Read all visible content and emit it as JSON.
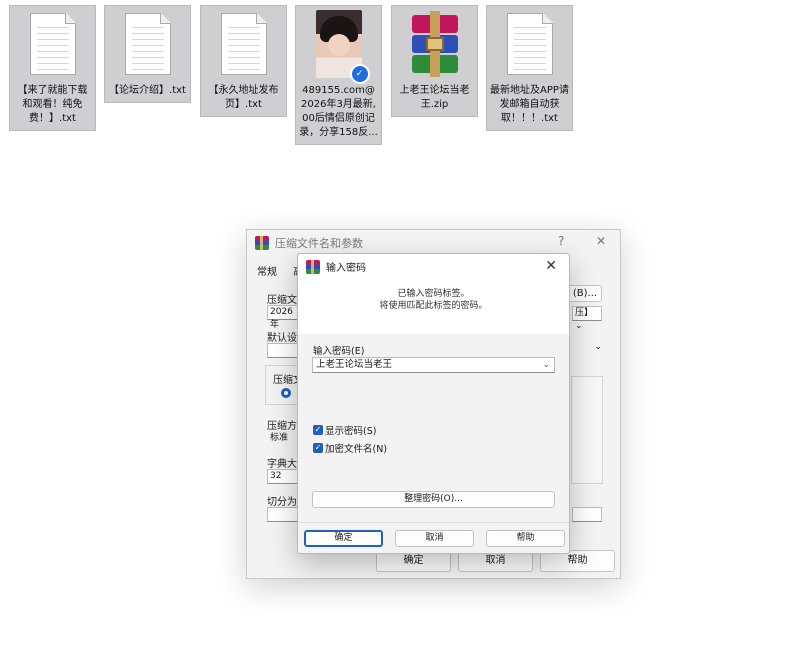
{
  "desktop_files": [
    {
      "name": "【来了就能下载和观看！纯免费！】.txt",
      "type": "txt"
    },
    {
      "name": "【论坛介绍】.txt",
      "type": "txt"
    },
    {
      "name": "【永久地址发布页】.txt",
      "type": "txt"
    },
    {
      "name": "489155.com@2026年3月最新,00后情侣原创记录，分享158反...",
      "type": "image"
    },
    {
      "name": "上老王论坛当老王.zip",
      "type": "zip"
    },
    {
      "name": "最新地址及APP请发邮箱自动获取！！！.txt",
      "type": "txt"
    }
  ],
  "main_dialog": {
    "title": "压缩文件名和参数",
    "help_glyph": "?",
    "close_glyph": "✕",
    "tab_general": "常规",
    "tab_advanced_partial": "高",
    "label_archive_name": "压缩文件",
    "archive_name_value": "2026年",
    "browse_partial": "(B)...",
    "format_partial": "压】",
    "label_default": "默认设置",
    "label_format": "压缩文",
    "label_method": "压缩方",
    "method_value": "标准",
    "label_dict": "字典大小",
    "dict_value": "32",
    "label_split": "切分为分",
    "ok_label": "确定",
    "cancel_label": "取消",
    "help_label": "帮助"
  },
  "password_dialog": {
    "title": "输入密码",
    "close_glyph": "✕",
    "info_line1": "已输入密码标签。",
    "info_line2": "将使用匹配此标签的密码。",
    "password_label": "输入密码(E)",
    "password_value": "上老王论坛当老王",
    "show_password_label": "显示密码(S)",
    "show_password_checked": true,
    "encrypt_names_label": "加密文件名(N)",
    "encrypt_names_checked": true,
    "organize_label": "整理密码(O)...",
    "ok_label": "确定",
    "cancel_label": "取消",
    "help_label": "帮助"
  },
  "colors": {
    "accent": "#1f5fbf",
    "desktop_selection": "#cfcfd1"
  }
}
